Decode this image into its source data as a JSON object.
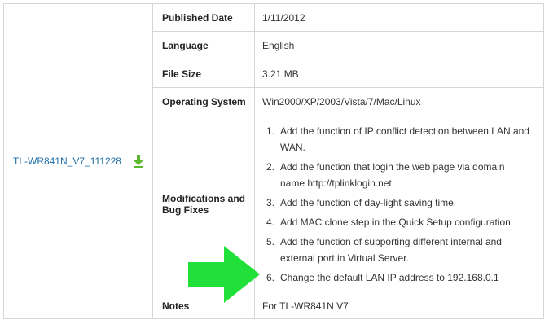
{
  "file": {
    "name": "TL-WR841N_V7_111228",
    "download_icon": "download-arrow-icon"
  },
  "rows": {
    "published_date": {
      "label": "Published Date",
      "value": "1/11/2012"
    },
    "language": {
      "label": "Language",
      "value": "English"
    },
    "file_size": {
      "label": "File Size",
      "value": "3.21 MB"
    },
    "operating_system": {
      "label": "Operating System",
      "value": "Win2000/XP/2003/Vista/7/Mac/Linux"
    },
    "modifications": {
      "label_line1": "Modifications and",
      "label_line2": "Bug Fixes",
      "items": [
        {
          "num": "1.",
          "line1": "Add the function of IP conflict detection between LAN and",
          "line2": "WAN."
        },
        {
          "num": "2.",
          "line1": "Add the function that login the web page via domain",
          "line2": "name http://tplinklogin.net."
        },
        {
          "num": "3.",
          "line1": "Add the function of day-light saving time.",
          "line2": ""
        },
        {
          "num": "4.",
          "line1": "Add MAC clone step in the Quick Setup configuration.",
          "line2": ""
        },
        {
          "num": "5.",
          "line1": "Add the function of supporting different internal and",
          "line2": "external port in Virtual Server."
        },
        {
          "num": "6.",
          "line1": "Change the default LAN IP address to 192.168.0.1",
          "line2": ""
        }
      ]
    },
    "notes": {
      "label": "Notes",
      "value": "For TL-WR841N V7"
    }
  },
  "colors": {
    "border": "#d6d6d6",
    "link": "#1f6fa8",
    "arrow": "#22e03a",
    "download_icon": "#5cb82e"
  },
  "annotation": {
    "icon": "green-arrow-icon"
  }
}
